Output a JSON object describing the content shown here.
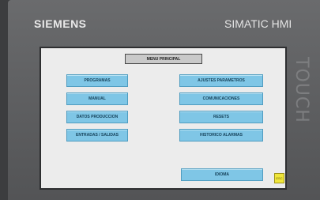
{
  "device": {
    "brand": "SIEMENS",
    "model": "SIMATIC HMI",
    "side_label": "TOUCH"
  },
  "screen": {
    "title": "MENU PRINCIPAL",
    "left_buttons": [
      "PROGRAMAS",
      "MANUAL",
      "DATOS PRODUCCION",
      "ENTRADAS / SALIDAS"
    ],
    "right_buttons": [
      "AJUSTES PARAMETROS",
      "COMUNICACIONES",
      "RESETS",
      "HISTORICO ALARMAS",
      "IDIOMA"
    ],
    "exit_label": "ESC"
  },
  "colors": {
    "button_fill": "#7fc6e6",
    "screen_background": "#ececec",
    "exit_button": "#f0e63a"
  }
}
